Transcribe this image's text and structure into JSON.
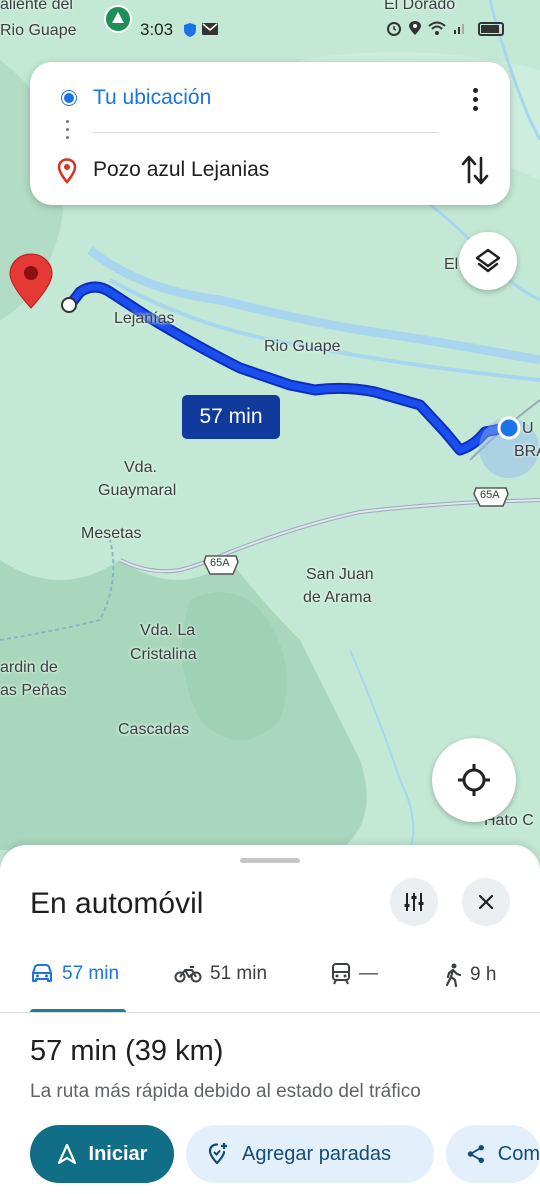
{
  "status_bar": {
    "time": "3:03",
    "overlay_text_1": "aliente del",
    "overlay_text_2": "Rio Guape",
    "overlay_text_3": "El Dorado",
    "icons": [
      "shield-icon",
      "mail-icon",
      "alarm-icon",
      "location-icon",
      "wifi-icon",
      "signal-icon",
      "battery-icon"
    ]
  },
  "route_card": {
    "origin": "Tu ubicación",
    "destination": "Pozo azul Lejanias"
  },
  "map": {
    "labels": {
      "lejanias": "Lejanías",
      "rio_guape": "Rio Guape",
      "guaymaral_1": "Vda.",
      "guaymaral_2": "Guaymaral",
      "mesetas": "Mesetas",
      "route_65a_1": "65A",
      "route_65a_2": "65A",
      "san_juan_1": "San Juan",
      "san_juan_2": "de Arama",
      "cristalina_1": "Vda. La",
      "cristalina_2": "Cristalina",
      "jardin_1": "ardin de",
      "jardin_2": "as Peñas",
      "cascadas": "Cascadas",
      "hato": "Hato C",
      "el": "El",
      "bra_1": "U",
      "bra_2": "BRA"
    },
    "route_time_badge": "57 min",
    "colors": {
      "route": "#1a3fd1",
      "water": "#a9d6ef",
      "land": "#bfe6d3",
      "accent": "#1a73e8"
    }
  },
  "sheet": {
    "title": "En automóvil",
    "modes": [
      {
        "name": "car",
        "label": "57 min"
      },
      {
        "name": "motorcycle",
        "label": "51 min"
      },
      {
        "name": "transit",
        "label": "—"
      },
      {
        "name": "walk",
        "label": "9 h"
      }
    ],
    "summary": "57 min (39 km)",
    "subtitle": "La ruta más rápida debido al estado del tráfico",
    "actions": {
      "start": "Iniciar",
      "add_stops": "Agregar paradas",
      "share": "Com"
    }
  }
}
